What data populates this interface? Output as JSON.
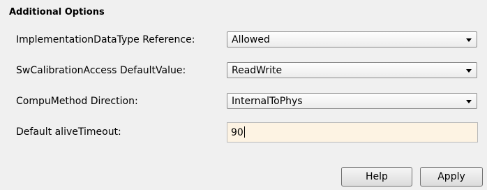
{
  "section": {
    "title": "Additional Options"
  },
  "options": [
    {
      "label": "ImplementationDataType Reference:",
      "value": "Allowed"
    },
    {
      "label": "SwCalibrationAccess DefaultValue:",
      "value": "ReadWrite"
    },
    {
      "label": "CompuMethod Direction:",
      "value": "InternalToPhys"
    }
  ],
  "alive_timeout": {
    "label": "Default aliveTimeout:",
    "value": "90"
  },
  "buttons": {
    "help_label": "Help",
    "apply_label": "Apply"
  }
}
